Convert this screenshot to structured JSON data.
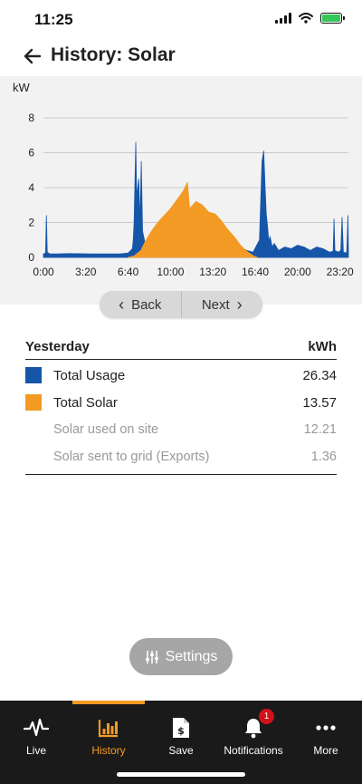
{
  "status": {
    "time": "11:25"
  },
  "header": {
    "title": "History: Solar"
  },
  "chart_data": {
    "type": "area",
    "ylabel": "kW",
    "ylim": [
      0,
      8
    ],
    "yticks": [
      "0",
      "2",
      "4",
      "6",
      "8"
    ],
    "xlim": [
      0,
      1440
    ],
    "xtick_labels": [
      "0:00",
      "3:20",
      "6:40",
      "10:00",
      "13:20",
      "16:40",
      "20:00",
      "23:20"
    ],
    "grid": true,
    "series": [
      {
        "name": "Total Usage",
        "color": "#1656a8",
        "x": [
          0,
          10,
          14,
          18,
          30,
          60,
          120,
          240,
          360,
          400,
          420,
          424,
          428,
          436,
          440,
          450,
          456,
          462,
          468,
          480,
          510,
          540,
          600,
          660,
          720,
          780,
          840,
          900,
          960,
          990,
          1020,
          1032,
          1040,
          1046,
          1052,
          1058,
          1064,
          1070,
          1080,
          1090,
          1110,
          1140,
          1170,
          1200,
          1230,
          1260,
          1290,
          1320,
          1350,
          1368,
          1372,
          1376,
          1392,
          1404,
          1410,
          1416,
          1432,
          1438,
          1440
        ],
        "y": [
          0.2,
          0.25,
          2.4,
          0.3,
          0.2,
          0.2,
          0.22,
          0.2,
          0.2,
          0.25,
          0.5,
          1.0,
          2.0,
          6.6,
          3.5,
          4.5,
          2.0,
          5.5,
          1.5,
          0.8,
          1.4,
          1.9,
          2.6,
          2.9,
          2.7,
          2.1,
          1.4,
          0.8,
          0.4,
          0.3,
          1.0,
          5.5,
          6.1,
          4.2,
          2.5,
          1.8,
          0.9,
          1.2,
          0.6,
          0.8,
          0.4,
          0.6,
          0.5,
          0.7,
          0.6,
          0.4,
          0.6,
          0.5,
          0.3,
          0.35,
          2.2,
          0.4,
          0.3,
          0.4,
          2.3,
          0.3,
          0.25,
          2.4,
          0.3
        ]
      },
      {
        "name": "Total Solar",
        "color": "#f39a24",
        "x": [
          400,
          430,
          460,
          480,
          510,
          540,
          570,
          600,
          630,
          660,
          680,
          690,
          720,
          750,
          780,
          810,
          840,
          870,
          900,
          930,
          960,
          990,
          1010
        ],
        "y": [
          0,
          0.1,
          0.4,
          0.9,
          1.5,
          2.0,
          2.4,
          2.8,
          3.3,
          3.8,
          4.3,
          2.8,
          3.2,
          3.0,
          2.6,
          2.5,
          2.1,
          1.6,
          1.2,
          0.7,
          0.35,
          0.1,
          0
        ]
      }
    ]
  },
  "nav": {
    "back_label": "Back",
    "next_label": "Next"
  },
  "summary": {
    "period_label": "Yesterday",
    "unit_label": "kWh",
    "rows": [
      {
        "label": "Total Usage",
        "value": "26.34",
        "color": "#1656a8"
      },
      {
        "label": "Total Solar",
        "value": "13.57",
        "color": "#f39a24"
      }
    ],
    "sub_rows": [
      {
        "label": "Solar used on site",
        "value": "12.21"
      },
      {
        "label": "Solar sent to grid (Exports)",
        "value": "1.36"
      }
    ]
  },
  "settings": {
    "label": "Settings"
  },
  "tabbar": {
    "active_color": "#f59a23",
    "items": [
      {
        "label": "Live",
        "icon": "pulse-icon"
      },
      {
        "label": "History",
        "icon": "bar-chart-icon"
      },
      {
        "label": "Save",
        "icon": "dollar-document-icon"
      },
      {
        "label": "Notifications",
        "icon": "bell-icon",
        "badge": "1"
      },
      {
        "label": "More",
        "icon": "more-dots-icon"
      }
    ]
  }
}
